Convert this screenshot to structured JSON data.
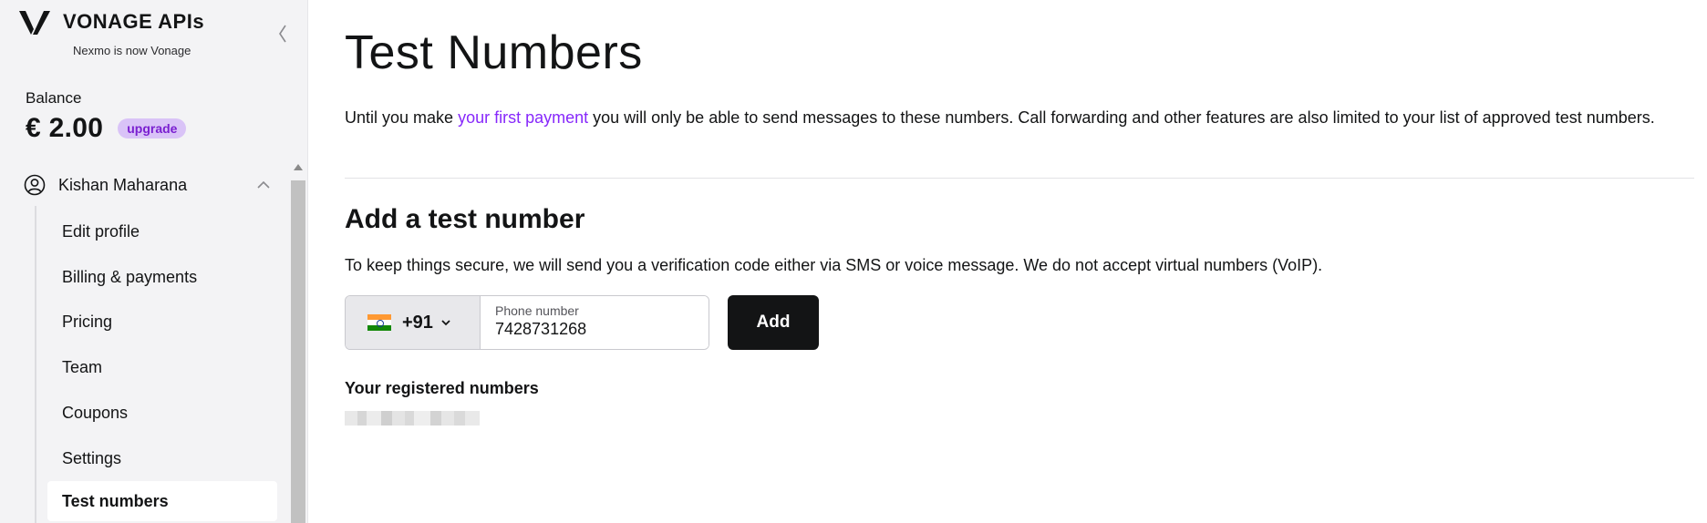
{
  "sidebar": {
    "brand_name": "VONAGE APIs",
    "brand_sub": "Nexmo is now Vonage",
    "balance_label": "Balance",
    "balance_value": "€ 2.00",
    "upgrade_label": "upgrade",
    "user_name": "Kishan Maharana",
    "items": [
      {
        "label": "Edit profile"
      },
      {
        "label": "Billing & payments"
      },
      {
        "label": "Pricing"
      },
      {
        "label": "Team"
      },
      {
        "label": "Coupons"
      },
      {
        "label": "Settings"
      },
      {
        "label": "Test numbers",
        "active": true
      }
    ]
  },
  "main": {
    "title": "Test Numbers",
    "intro_before": "Until you make ",
    "intro_link": "your first payment",
    "intro_after": " you will only be able to send messages to these numbers. Call forwarding and other features are also limited to your list of approved test numbers.",
    "add_title": "Add a test number",
    "secure_note": "To keep things secure, we will send you a verification code either via SMS or voice message. We do not accept virtual numbers (VoIP).",
    "country_code": "+91",
    "phone_label": "Phone number",
    "phone_value": "7428731268",
    "add_button": "Add",
    "registered_title": "Your registered numbers"
  },
  "colors": {
    "accent": "#8728fb",
    "badge_bg": "#d9c3f7",
    "button_bg": "#131415",
    "sidebar_bg": "#f3f3f5"
  },
  "icons": {
    "brand": "vonage-logo-icon",
    "collapse": "chevron-left-icon",
    "user": "user-circle-icon",
    "expand": "chevron-up-icon",
    "dropdown": "chevron-down-icon",
    "flag": "india-flag-icon"
  }
}
